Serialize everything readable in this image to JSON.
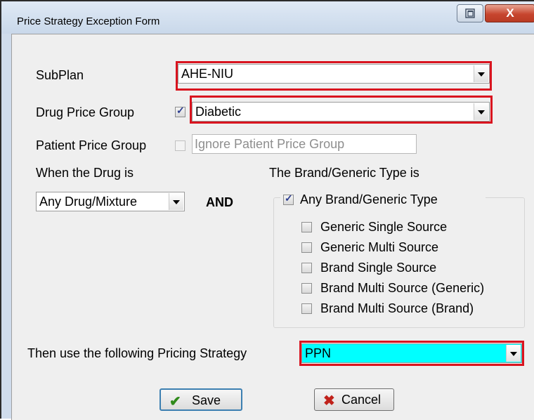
{
  "window": {
    "title": "Price Strategy Exception Form",
    "restore_icon": "restore-icon",
    "close_label": "X"
  },
  "form": {
    "subplan_label": "SubPlan",
    "subplan_value": "AHE-NIU",
    "drug_price_group_label": "Drug Price Group",
    "drug_price_group_checked": true,
    "drug_price_group_value": "Diabetic",
    "patient_price_group_label": "Patient Price Group",
    "patient_price_group_checked": false,
    "patient_price_group_placeholder": "Ignore Patient Price Group",
    "when_drug_label": "When the Drug is",
    "when_drug_value": "Any Drug/Mixture",
    "and_label": "AND",
    "brand_generic_label": "The Brand/Generic Type is",
    "any_brand_generic_label": "Any Brand/Generic Type",
    "any_brand_generic_checked": true,
    "types": [
      {
        "label": "Generic Single Source",
        "checked": false
      },
      {
        "label": "Generic Multi Source",
        "checked": false
      },
      {
        "label": "Brand Single Source",
        "checked": false
      },
      {
        "label": "Brand Multi Source (Generic)",
        "checked": false
      },
      {
        "label": "Brand Multi Source (Brand)",
        "checked": false
      }
    ],
    "pricing_strategy_label": "Then use the following Pricing Strategy",
    "pricing_strategy_value": "PPN",
    "pricing_strategy_bg": "#00ffff",
    "highlight_color": "#d9141f"
  },
  "buttons": {
    "save_label": "Save",
    "save_icon": "checkmark-icon",
    "cancel_label": "Cancel",
    "cancel_icon": "x-icon"
  }
}
